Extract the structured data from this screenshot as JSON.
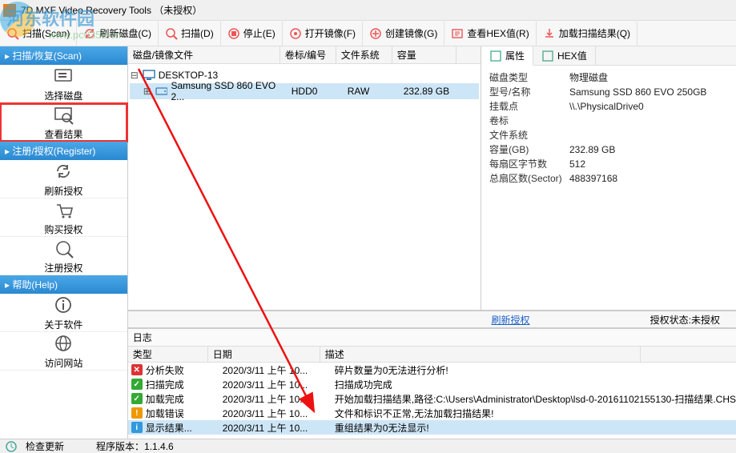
{
  "title": "7D MXF Video Recovery Tools  （未授权）",
  "watermark": {
    "text": "河东软件园",
    "url": "www.pc0359.cn"
  },
  "toolbar": [
    {
      "id": "scan-recover",
      "label": "扫描(Scan)",
      "key": "scan"
    },
    {
      "id": "refresh-disks",
      "label": "刷新磁盘(C)",
      "key": "refresh"
    },
    {
      "id": "scan",
      "label": "扫描(D)",
      "key": "scan2"
    },
    {
      "id": "stop",
      "label": "停止(E)",
      "key": "stop"
    },
    {
      "id": "open-image",
      "label": "打开镜像(F)",
      "key": "open"
    },
    {
      "id": "create-image",
      "label": "创建镜像(G)",
      "key": "create"
    },
    {
      "id": "view-hex",
      "label": "查看HEX值(R)",
      "key": "hex"
    },
    {
      "id": "load-scan",
      "label": "加载扫描结果(Q)",
      "key": "load"
    }
  ],
  "sidebar": {
    "groups": [
      {
        "id": "scan",
        "title": "扫描/恢复(Scan)",
        "items": [
          {
            "id": "select-disk",
            "label": "选择磁盘"
          },
          {
            "id": "view-result",
            "label": "查看结果",
            "highlight": true
          }
        ]
      },
      {
        "id": "register",
        "title": "注册/授权(Register)",
        "items": [
          {
            "id": "refresh-auth",
            "label": "刷新授权"
          },
          {
            "id": "buy-auth",
            "label": "购买授权"
          },
          {
            "id": "reg-auth",
            "label": "注册授权"
          }
        ]
      },
      {
        "id": "help",
        "title": "帮助(Help)",
        "items": [
          {
            "id": "about",
            "label": "关于软件"
          },
          {
            "id": "website",
            "label": "访问网站"
          }
        ]
      }
    ]
  },
  "tree": {
    "cols": [
      {
        "id": "disk",
        "label": "磁盘/镜像文件",
        "w": 190
      },
      {
        "id": "vol",
        "label": "卷标/编号",
        "w": 70
      },
      {
        "id": "fs",
        "label": "文件系统",
        "w": 70
      },
      {
        "id": "cap",
        "label": "容量",
        "w": 80
      }
    ],
    "root": {
      "label": "DESKTOP-13"
    },
    "child": {
      "label": "Samsung SSD 860 EVO 2...",
      "vol": "HDD0",
      "fs": "RAW",
      "cap": "232.89 GB",
      "selected": true
    }
  },
  "prop": {
    "tabs": [
      {
        "id": "attr",
        "label": "属性",
        "active": true
      },
      {
        "id": "hex",
        "label": "HEX值"
      }
    ],
    "rows": [
      {
        "k": "磁盘类型",
        "v": "物理磁盘"
      },
      {
        "k": "型号/名称",
        "v": "Samsung SSD 860 EVO 250GB"
      },
      {
        "k": "挂载点",
        "v": "\\\\.\\PhysicalDrive0"
      },
      {
        "k": "卷标",
        "v": ""
      },
      {
        "k": "文件系统",
        "v": ""
      },
      {
        "k": "容量(GB)",
        "v": "232.89 GB"
      },
      {
        "k": "每扇区字节数",
        "v": "512"
      },
      {
        "k": "总扇区数(Sector)",
        "v": "488397168"
      }
    ]
  },
  "auth": {
    "link": "刷新授权",
    "state_label": "授权状态:",
    "state": "未授权"
  },
  "logs": {
    "title": "日志",
    "cols": [
      {
        "id": "type",
        "label": "类型"
      },
      {
        "id": "date",
        "label": "日期"
      },
      {
        "id": "desc",
        "label": "描述"
      }
    ],
    "rows": [
      {
        "ic": "err",
        "type": "分析失败",
        "date": "2020/3/11 上午 10...",
        "desc": "碎片数量为0无法进行分析!"
      },
      {
        "ic": "ok",
        "type": "扫描完成",
        "date": "2020/3/11 上午 10...",
        "desc": "扫描成功完成"
      },
      {
        "ic": "ok",
        "type": "加载完成",
        "date": "2020/3/11 上午 10...",
        "desc": "开始加载扫描结果,路径:C:\\Users\\Administrator\\Desktop\\lsd-0-20161102155130-扫描结果.CHS"
      },
      {
        "ic": "warn",
        "type": "加载错误",
        "date": "2020/3/11 上午 10...",
        "desc": "文件和标识不正常,无法加载扫描结果!"
      },
      {
        "ic": "info",
        "type": "显示结果...",
        "date": "2020/3/11 上午 10...",
        "desc": "重组结果为0无法显示!",
        "selected": true
      }
    ]
  },
  "status": {
    "check": "检查更新",
    "ver_label": "程序版本：",
    "ver": "1.1.4.6"
  }
}
